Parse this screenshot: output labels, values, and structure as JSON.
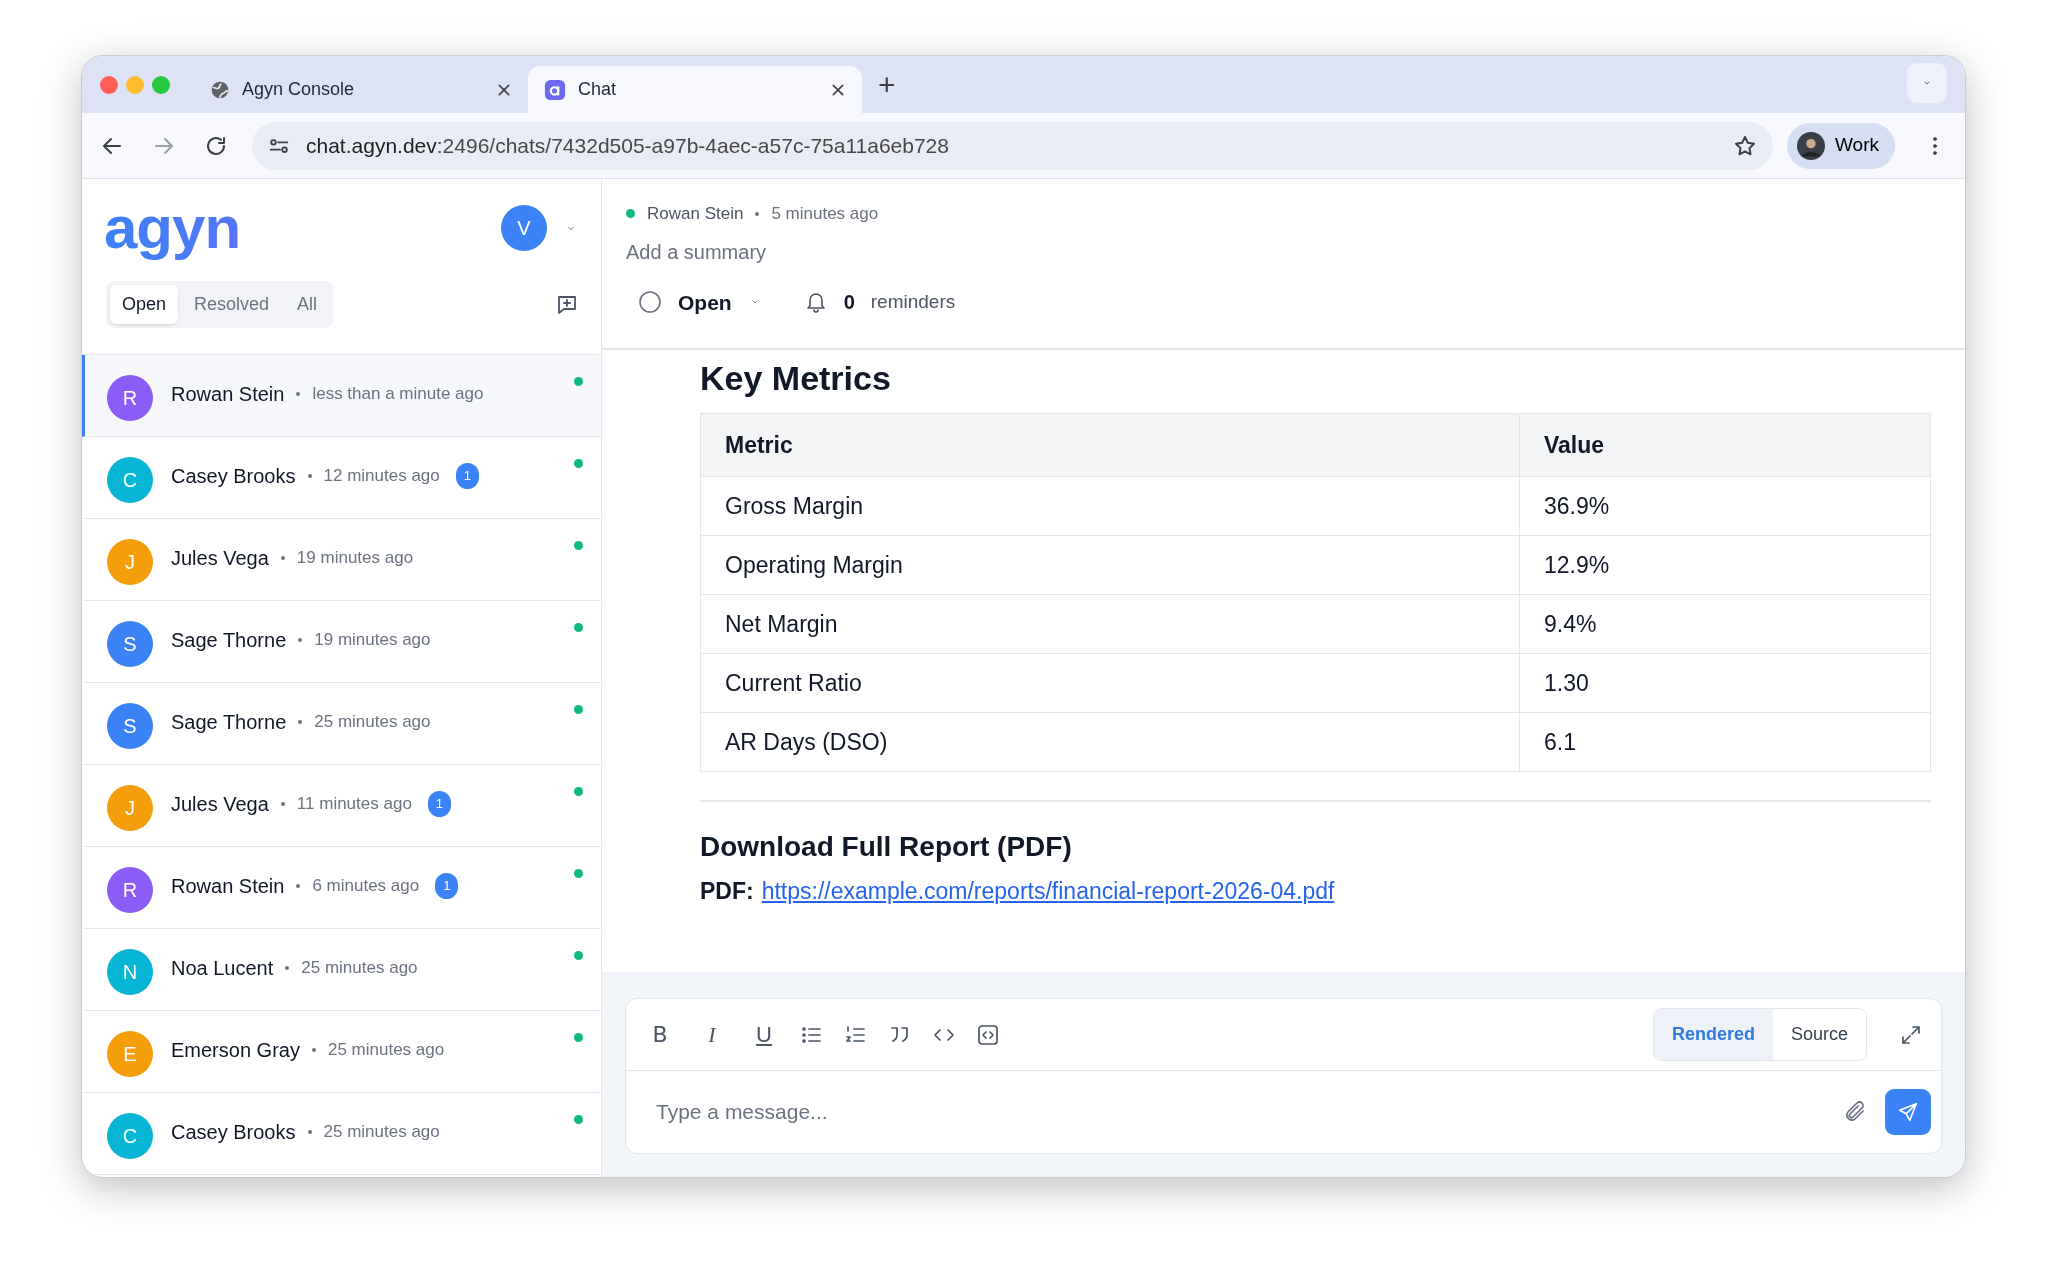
{
  "browser": {
    "tabs": [
      {
        "title": "Agyn Console",
        "kind": "globe",
        "selected": false
      },
      {
        "title": "Chat",
        "kind": "app",
        "selected": true
      }
    ],
    "new_tab": "+",
    "url": {
      "host": "chat.agyn.dev",
      "path": ":2496/chats/7432d505-a97b-4aec-a57c-75a11a6eb728"
    },
    "profile": "Work"
  },
  "sidebar": {
    "logo": "agyn",
    "user_initial": "V",
    "filters": [
      {
        "label": "Open",
        "selected": true
      },
      {
        "label": "Resolved",
        "selected": false
      },
      {
        "label": "All",
        "selected": false
      }
    ],
    "conversations": [
      {
        "initial": "R",
        "name": "Rowan Stein",
        "time": "less than a minute ago",
        "color": "#8b5cf6",
        "online": true,
        "selected": true
      },
      {
        "initial": "C",
        "name": "Casey Brooks",
        "time": "12 minutes ago",
        "unread": "1",
        "color": "#06b6d4",
        "online": true,
        "selected": false
      },
      {
        "initial": "J",
        "name": "Jules Vega",
        "time": "19 minutes ago",
        "color": "#f59e0b",
        "online": true,
        "selected": false
      },
      {
        "initial": "S",
        "name": "Sage Thorne",
        "time": "19 minutes ago",
        "color": "#3b82f6",
        "online": true,
        "selected": false
      },
      {
        "initial": "S",
        "name": "Sage Thorne",
        "time": "25 minutes ago",
        "color": "#3b82f6",
        "online": true,
        "selected": false
      },
      {
        "initial": "J",
        "name": "Jules Vega",
        "time": "11 minutes ago",
        "unread": "1",
        "color": "#f59e0b",
        "online": true,
        "selected": false
      },
      {
        "initial": "R",
        "name": "Rowan Stein",
        "time": "6 minutes ago",
        "unread": "1",
        "color": "#8b5cf6",
        "online": true,
        "selected": false
      },
      {
        "initial": "N",
        "name": "Noa Lucent",
        "time": "25 minutes ago",
        "color": "#06b6d4",
        "online": true,
        "selected": false
      },
      {
        "initial": "E",
        "name": "Emerson Gray",
        "time": "25 minutes ago",
        "color": "#f59e0b",
        "online": true,
        "selected": false
      },
      {
        "initial": "C",
        "name": "Casey Brooks",
        "time": "25 minutes ago",
        "color": "#06b6d4",
        "online": true,
        "selected": false
      }
    ]
  },
  "chat": {
    "author": "Rowan Stein",
    "online": true,
    "time": "5 minutes ago",
    "summary_placeholder": "Add a summary",
    "status": "Open",
    "reminder_count": "0",
    "reminder_label": "reminders"
  },
  "message": {
    "heading": "Key Metrics",
    "table": {
      "columns": [
        "Metric",
        "Value"
      ],
      "rows": [
        [
          "Gross Margin",
          "36.9%"
        ],
        [
          "Operating Margin",
          "12.9%"
        ],
        [
          "Net Margin",
          "9.4%"
        ],
        [
          "Current Ratio",
          "1.30"
        ],
        [
          "AR Days (DSO)",
          "6.1"
        ]
      ]
    },
    "section_heading": "Download Full Report (PDF)",
    "pdf_label": "PDF:",
    "pdf_link": "https://example.com/reports/financial-report-2026-04.pdf"
  },
  "composer": {
    "format_buttons": [
      {
        "label": "B",
        "kind": "bold"
      },
      {
        "label": "I",
        "kind": "italic"
      },
      {
        "label": "U",
        "kind": "underline"
      }
    ],
    "modes": [
      {
        "label": "Rendered",
        "selected": true
      },
      {
        "label": "Source",
        "selected": false
      }
    ],
    "placeholder": "Type a message..."
  }
}
